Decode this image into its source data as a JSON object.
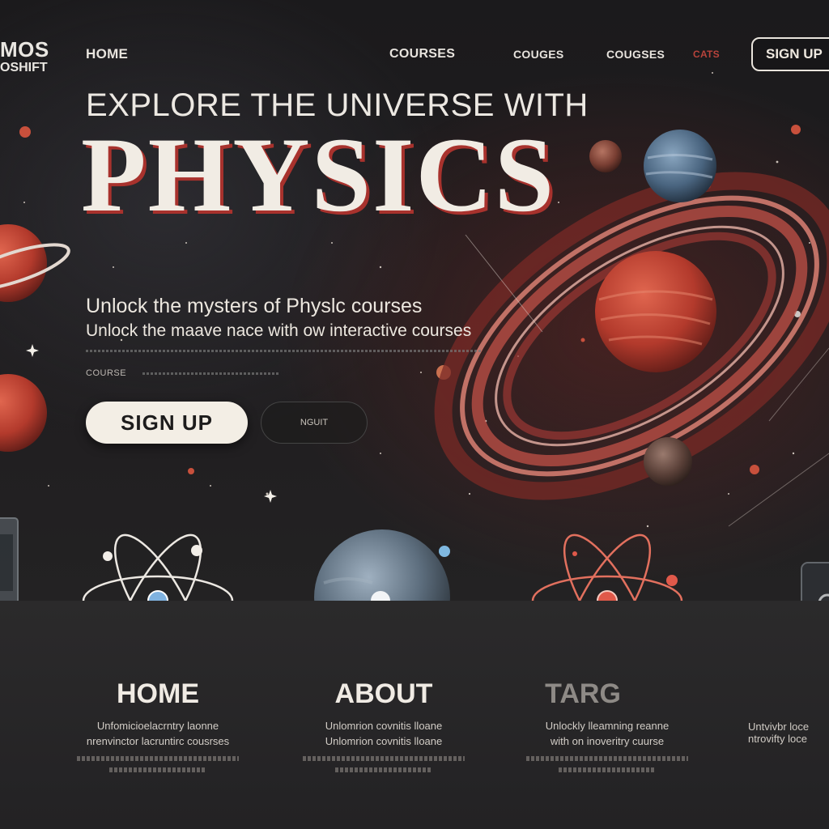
{
  "brand": {
    "line1": "MOS",
    "line2": "OSHIFT"
  },
  "nav": {
    "home": "HOME",
    "courses1": "COURSES",
    "courses2": "COUGES",
    "courses3": "COUGSES",
    "extra": "CATS",
    "signup": "SIGN UP"
  },
  "hero": {
    "pretitle": "EXPLORE THE UNIVERSE WITH",
    "title": "PHYSICS",
    "sub1": "Unlock the mysters of Physlc courses",
    "sub2": "Unlock the maave nace with ow interactive courses",
    "courses_tag": "COURSE",
    "primary_button": "SIGN UP",
    "secondary_button": "NGUIT"
  },
  "features": [
    {
      "title": "HOME",
      "text1": "Unfomicioelacrntry laonne",
      "text2": "nrenvinctor lacruntirc cousrses"
    },
    {
      "title": "ABOUT",
      "text1": "Unlomrion covnitis lloane",
      "text2": "Unlomrion covnitis lloane"
    },
    {
      "title": "TARG",
      "text1": "Unlockly lleamning reanne",
      "text2": "with on inoveritry cuurse"
    },
    {
      "title": "",
      "text1": "Untvivbr loce",
      "text2": "ntrovifty loce"
    }
  ],
  "colors": {
    "accent_red": "#a8322d",
    "cream": "#f1ece4",
    "background": "#1b1a1c"
  },
  "icons": [
    "atom-icon",
    "planet-icon",
    "atom-icon-red",
    "ringed-planet-icon"
  ]
}
